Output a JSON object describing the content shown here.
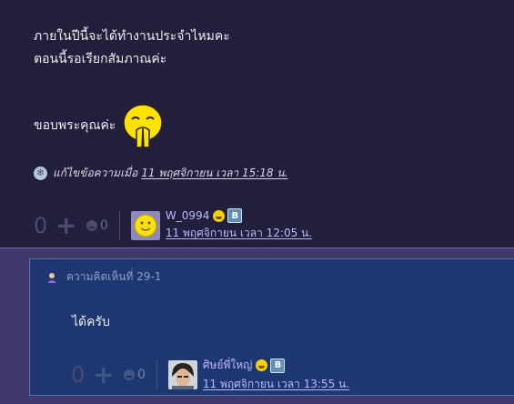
{
  "post": {
    "lines": [
      "ภายในปีนี้จะได้ทำงานประจำไหมคะ",
      "ตอนนี้รอเรียกสัมภาณค่ะ"
    ],
    "thanks": "ขอบพระคุณค่ะ",
    "edited": {
      "prefix": "แก้ไขข้อความเมื่อ",
      "date": "11 พฤศจิกายน เวลา 15:18 น."
    },
    "votes": {
      "score": "0",
      "emotion_count": "0"
    },
    "author": {
      "name": "W_0994",
      "date": "11 พฤศจิกายน เวลา 12:05 น.",
      "badge": "B"
    }
  },
  "comment": {
    "header": "ความคิดเห็นที่ 29-1",
    "text": "ได้ครับ",
    "votes": {
      "score": "0",
      "emotion_count": "0"
    },
    "author": {
      "name": "ศิษย์พี่ใหญ่",
      "date": "11 พฤศจิกายน เวลา 13:55 น.",
      "badge": "B"
    }
  },
  "colors": {
    "background": "#221f3d",
    "comment_bg": "#1e3770",
    "link": "#b9b9ff"
  }
}
